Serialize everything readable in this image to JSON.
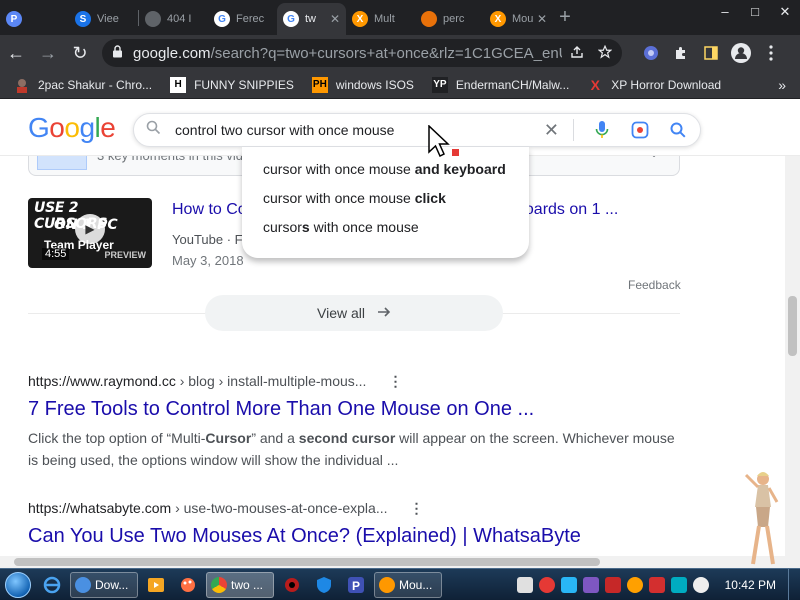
{
  "tabs": [
    {
      "label": "",
      "favicon_color": "#5b87f5",
      "favicon_letter": "P"
    },
    {
      "label": "Viee",
      "favicon_color": "#1a73e8",
      "favicon_letter": "S"
    },
    {
      "label": "404 I",
      "favicon_color": "#5f6368",
      "favicon_letter": ""
    },
    {
      "label": "Ferec",
      "favicon_color": "#4285f4",
      "favicon_letter": "G"
    },
    {
      "label": "tw",
      "favicon_color": "#4285f4",
      "favicon_letter": "G",
      "active": true
    },
    {
      "label": "Mult",
      "favicon_color": "#ff9800",
      "favicon_letter": "X"
    },
    {
      "label": "perc",
      "favicon_color": "#e8710a",
      "favicon_letter": ""
    },
    {
      "label": "Mou",
      "favicon_color": "#ff9800",
      "favicon_letter": "X"
    }
  ],
  "window": {
    "minimize": "–",
    "maximize": "□",
    "close": "✕",
    "new_tab": "+"
  },
  "toolbar": {
    "back": "←",
    "forward": "→",
    "reload": "↻",
    "url_host": "google.com",
    "url_path": "/search?q=two+cursors+at+once&rlz=1C1GCEA_enU..."
  },
  "bookmarks": [
    {
      "label": "2pac Shakur - Chro...",
      "icon": "2pac-icon",
      "color": "#c0392b"
    },
    {
      "label": "FUNNY SNIPPIES",
      "icon": "h-icon",
      "color": "#ffffff"
    },
    {
      "label": "windows ISOS",
      "icon": "ph-icon",
      "color": "#ff9800"
    },
    {
      "label": "EndermanCH/Malw...",
      "icon": "yp-icon",
      "color": "#ffffff"
    },
    {
      "label": "XP Horror Download",
      "icon": "x-icon",
      "color": "#e53935"
    }
  ],
  "bookmarks_more": "»",
  "google": {
    "logo": [
      "G",
      "o",
      "o",
      "g",
      "l",
      "e"
    ],
    "query": "control two cursor with once mouse",
    "suggestions": [
      {
        "base": "cursor with once mouse ",
        "bold": "and keyboard"
      },
      {
        "base": "cursor with once mouse ",
        "bold": "click"
      },
      {
        "pre": "cursor",
        "bold": "s",
        "post": " with once mouse"
      }
    ]
  },
  "key_moments": {
    "text": "3 key moments in this video",
    "chevron": "⌄"
  },
  "video": {
    "thumb_line1": "USE 2 CURSORS",
    "thumb_line2": "ON 1 PC",
    "thumb_line3": "Team Player",
    "thumb_tail": "PREVIEW",
    "duration": "4:55",
    "title_left": "How to Co",
    "title_right": "boards on 1 ...",
    "source": "YouTube · F",
    "date": "May 3, 2018"
  },
  "feedback": "Feedback",
  "view_all": "View all",
  "results": [
    {
      "url_host": "https://www.raymond.cc",
      "url_path": " › blog › install-multiple-mous...",
      "title": "7 Free Tools to Control More Than One Mouse on One ...",
      "snippet_parts": [
        {
          "t": "Click the top option of “Multi-",
          "b": false
        },
        {
          "t": "Cursor",
          "b": true
        },
        {
          "t": "” and a ",
          "b": false
        },
        {
          "t": "second cursor",
          "b": true
        },
        {
          "t": " will appear on the screen. Whichever mouse is being used, the options window will show the individual ...",
          "b": false
        }
      ]
    },
    {
      "url_host": "https://whatsabyte.com",
      "url_path": " › use-two-mouses-at-once-expla...",
      "title": "Can You Use Two Mouses At Once? (Explained) | WhatsaByte"
    }
  ],
  "taskbar": {
    "buttons": [
      {
        "label": "Dow...",
        "color": "#4a90e2"
      },
      {
        "label": "two ...",
        "color": "#4285f4",
        "active": true
      },
      {
        "label": "Mou...",
        "color": "#ff9800"
      }
    ],
    "clock": "10:42 PM"
  }
}
